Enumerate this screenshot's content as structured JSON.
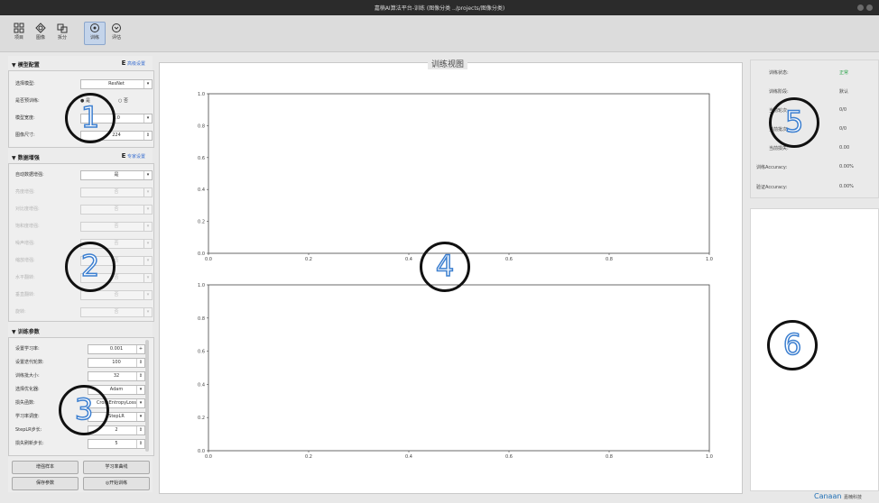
{
  "window": {
    "title": "嘉楠AI算法平台-训练 (图像分类 ../projects/图像分类)"
  },
  "toolbar": {
    "items": [
      {
        "label": "项目",
        "icon": "project-icon"
      },
      {
        "label": "图像",
        "icon": "image-icon"
      },
      {
        "label": "拆分",
        "icon": "split-icon"
      },
      {
        "label": "训练",
        "icon": "train-icon",
        "active": true
      },
      {
        "label": "评估",
        "icon": "evaluate-icon"
      }
    ]
  },
  "model_config": {
    "header": "模型配置",
    "link": "高级设置",
    "model_label": "选择模型:",
    "model_value": "ResNet",
    "pretrain_label": "是否预训练:",
    "pretrain_yes": "是",
    "pretrain_no": "否",
    "width_label": "模型宽度:",
    "width_value": "1.0",
    "size_label": "图像尺寸:",
    "size_value": "224"
  },
  "augment": {
    "header": "数据增强",
    "link": "专家设置",
    "auto_label": "自动数据增强:",
    "auto_value": "是",
    "rows": [
      {
        "label": "亮度增强:",
        "value": "否"
      },
      {
        "label": "对比度增强:",
        "value": "否"
      },
      {
        "label": "饱和度增强:",
        "value": "否"
      },
      {
        "label": "噪声增强:",
        "value": "否"
      },
      {
        "label": "缩放增强:",
        "value": "否"
      },
      {
        "label": "水平翻转:",
        "value": "否"
      },
      {
        "label": "垂直翻转:",
        "value": "否"
      },
      {
        "label": "旋转:",
        "value": "否"
      }
    ]
  },
  "train_params": {
    "header": "训练参数",
    "rows": [
      {
        "label": "设置学习率:",
        "value": "0.001"
      },
      {
        "label": "设置迭代轮数:",
        "value": "100"
      },
      {
        "label": "训练批大小:",
        "value": "32"
      },
      {
        "label": "选择优化器:",
        "value": "Adam"
      },
      {
        "label": "损失函数:",
        "value": "CrossEntropyLoss"
      },
      {
        "label": "学习率调度:",
        "value": "StepLR"
      },
      {
        "label": "StepLR步长:",
        "value": "2"
      },
      {
        "label": "损失刷新步长:",
        "value": "5"
      }
    ]
  },
  "buttons": {
    "augment_sample": "增强样本",
    "lr_curve": "学习率曲线",
    "save_params": "保存参数",
    "start_train": "◎开始训练"
  },
  "view": {
    "title": "训练视图",
    "chart_data": [
      {
        "type": "line",
        "x": [],
        "y": [],
        "xlim": [
          0,
          1.0
        ],
        "ylim": [
          0,
          1.0
        ],
        "xticks": [
          "0.0",
          "0.2",
          "0.4",
          "0.6",
          "0.8",
          "1.0"
        ],
        "yticks": [
          "0.0",
          "0.2",
          "0.4",
          "0.6",
          "0.8",
          "1.0"
        ]
      },
      {
        "type": "line",
        "x": [],
        "y": [],
        "xlim": [
          0,
          1.0
        ],
        "ylim": [
          0,
          1.0
        ],
        "xticks": [
          "0.0",
          "0.2",
          "0.4",
          "0.6",
          "0.8",
          "1.0"
        ],
        "yticks": [
          "0.0",
          "0.2",
          "0.4",
          "0.6",
          "0.8",
          "1.0"
        ]
      }
    ]
  },
  "status": {
    "rows": [
      {
        "label": "训练状态:",
        "value": "正常",
        "color": "#2aa34a"
      },
      {
        "label": "训练阶段:",
        "value": "默认"
      },
      {
        "label": "当前轮次:",
        "value": "0/0"
      },
      {
        "label": "当前批次:",
        "value": "0/0"
      },
      {
        "label": "当前损失:",
        "value": "0.00"
      },
      {
        "label": "训练Accuracy:",
        "value": "0.00%"
      },
      {
        "label": "验证Accuracy:",
        "value": "0.00%"
      }
    ]
  },
  "brand": {
    "name": "Canaan",
    "sub": "嘉楠科技"
  },
  "annotations": [
    "1",
    "2",
    "3",
    "4",
    "5",
    "6"
  ]
}
